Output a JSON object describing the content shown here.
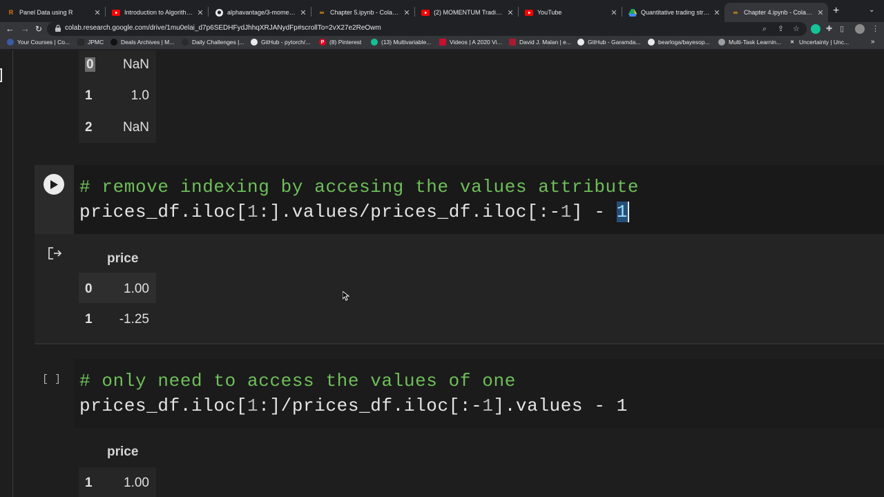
{
  "browser": {
    "tabs": [
      {
        "title": "Panel Data using R",
        "icon": "r-icon",
        "active": false
      },
      {
        "title": "Introduction to Algorithmic T",
        "icon": "youtube-icon",
        "active": false
      },
      {
        "title": "alphavantage/3-momentum",
        "icon": "github-icon",
        "active": false
      },
      {
        "title": "Chapter 5.ipynb - Colaborat",
        "icon": "colab-icon",
        "active": false
      },
      {
        "title": "(2) MOMENTUM Trading Str",
        "icon": "youtube-icon",
        "active": false
      },
      {
        "title": "YouTube",
        "icon": "youtube-icon",
        "active": false
      },
      {
        "title": "Quantitative trading strateg",
        "icon": "drive-icon",
        "active": false
      },
      {
        "title": "Chapter 4.ipynb - Colaborat",
        "icon": "colab-icon",
        "active": true
      }
    ],
    "url": "colab.research.google.com/drive/1mu0elai_d7p6SEDHFydJhhqXRJANydFp#scrollTo=2vX27e2ReOwm",
    "bookmarks": [
      {
        "label": "Your Courses | Co...",
        "icon": "courses-icon"
      },
      {
        "label": "JPMC",
        "icon": "folder-icon"
      },
      {
        "label": "Deals Archives | M...",
        "icon": "deals-icon"
      },
      {
        "label": "Daily Challenges |...",
        "icon": "challenges-icon"
      },
      {
        "label": "GitHub - pytorch/...",
        "icon": "github-icon"
      },
      {
        "label": "(8) Pinterest",
        "icon": "pinterest-icon"
      },
      {
        "label": "(13) Multivariable...",
        "icon": "khan-icon"
      },
      {
        "label": "Videos | A 2020 Vi...",
        "icon": "video-icon"
      },
      {
        "label": "David J. Malan | e...",
        "icon": "harvard-icon"
      },
      {
        "label": "GitHub - Garamda...",
        "icon": "github-icon"
      },
      {
        "label": "bearloga/bayesop...",
        "icon": "github-icon"
      },
      {
        "label": "Multi-Task Learnin...",
        "icon": "globe-icon"
      },
      {
        "label": "Uncertainty | Unc...",
        "icon": "x-icon"
      }
    ]
  },
  "notebook": {
    "top_output": {
      "rows": [
        {
          "index": "0",
          "value": "NaN"
        },
        {
          "index": "1",
          "value": "1.0"
        },
        {
          "index": "2",
          "value": "NaN"
        }
      ]
    },
    "cell1": {
      "comment": "# remove indexing by accesing the values attribute",
      "code_parts": [
        "prices_df.iloc[",
        "1",
        ":].values/prices_df.iloc[:-",
        "1",
        "] - ",
        "1"
      ],
      "output": {
        "header": "price",
        "rows": [
          {
            "index": "0",
            "value": "1.00"
          },
          {
            "index": "1",
            "value": "-1.25"
          }
        ]
      }
    },
    "cell2": {
      "execution_label": "[ ]",
      "comment": "# only need to access the values of one",
      "code_parts": [
        "prices_df.iloc[",
        "1",
        ":]/prices_df.iloc[:-",
        "1",
        "].values - ",
        "1"
      ],
      "output": {
        "header": "price",
        "rows": [
          {
            "index": "1",
            "value": "1.00"
          }
        ]
      }
    }
  }
}
